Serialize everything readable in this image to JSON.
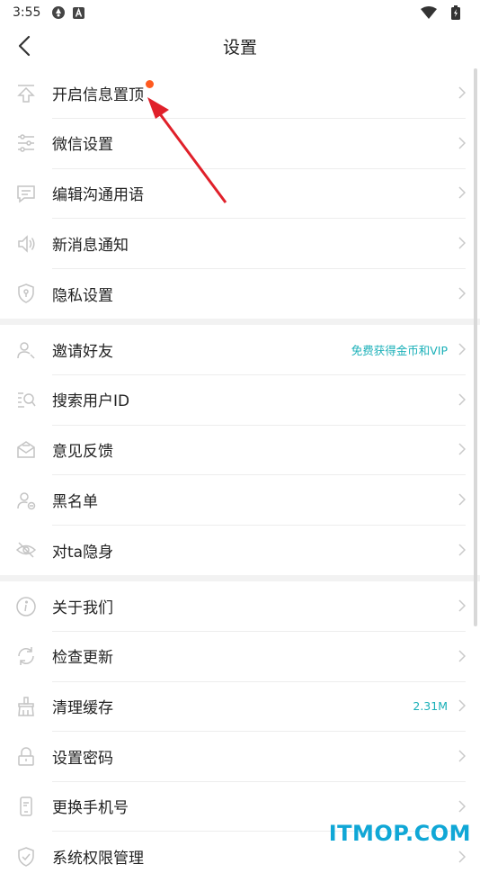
{
  "status_bar": {
    "time": "3:55"
  },
  "header": {
    "title": "设置"
  },
  "sections": [
    {
      "items": [
        {
          "icon": "pin-top-icon",
          "label": "开启信息置顶",
          "badge": "red-dot"
        },
        {
          "icon": "sliders-icon",
          "label": "微信设置"
        },
        {
          "icon": "message-icon",
          "label": "编辑沟通用语"
        },
        {
          "icon": "speaker-icon",
          "label": "新消息通知"
        },
        {
          "icon": "shield-icon",
          "label": "隐私设置"
        }
      ]
    },
    {
      "items": [
        {
          "icon": "user-add-icon",
          "label": "邀请好友",
          "value": "免费获得金币和VIP"
        },
        {
          "icon": "user-search-icon",
          "label": "搜索用户ID"
        },
        {
          "icon": "envelope-icon",
          "label": "意见反馈"
        },
        {
          "icon": "user-block-icon",
          "label": "黑名单"
        },
        {
          "icon": "eye-hidden-icon",
          "label": "对ta隐身"
        }
      ]
    },
    {
      "items": [
        {
          "icon": "info-icon",
          "label": "关于我们"
        },
        {
          "icon": "refresh-icon",
          "label": "检查更新"
        },
        {
          "icon": "broom-icon",
          "label": "清理缓存",
          "value": "2.31M"
        },
        {
          "icon": "lock-icon",
          "label": "设置密码"
        },
        {
          "icon": "phone-icon",
          "label": "更换手机号"
        },
        {
          "icon": "permission-icon",
          "label": "系统权限管理"
        }
      ]
    }
  ],
  "watermark": "ITMOP.COM",
  "colors": {
    "accent": "#1ab0b8",
    "badge": "#ff5a1f",
    "annotation": "#e0202a",
    "watermark": "#10a7d6"
  }
}
